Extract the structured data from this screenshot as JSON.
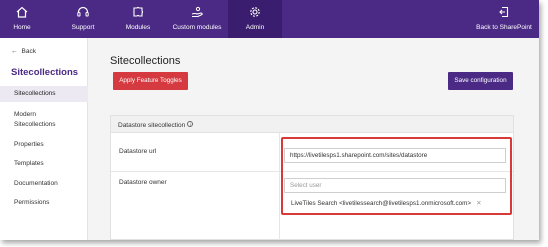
{
  "nav": {
    "items": [
      {
        "label": "Home",
        "icon": "home-icon"
      },
      {
        "label": "Support",
        "icon": "headset-icon"
      },
      {
        "label": "Modules",
        "icon": "puzzle-icon"
      },
      {
        "label": "Custom modules",
        "icon": "hand-icon"
      },
      {
        "label": "Admin",
        "icon": "gear-icon"
      }
    ],
    "back_to_sharepoint": "Back to SharePoint"
  },
  "sidebar": {
    "back_label": "Back",
    "title": "Sitecollections",
    "items": [
      {
        "label": "Sitecollections"
      },
      {
        "label": "Modern"
      },
      {
        "label": "Sitecollections"
      },
      {
        "label": "Properties"
      },
      {
        "label": "Templates"
      },
      {
        "label": "Documentation"
      },
      {
        "label": "Permissions"
      }
    ]
  },
  "main": {
    "title": "Sitecollections",
    "apply_button": "Apply Feature Toggles",
    "save_button": "Save configuration"
  },
  "panel": {
    "heading": "Datastore sitecollection",
    "url_label": "Datastore url",
    "url_value": "https://livetilesps1.sharepoint.com/sites/datastore",
    "owner_label": "Datastore owner",
    "owner_placeholder": "Select user",
    "owner_chip": "LiveTiles Search  <livetilessearch@livetilesps1.onmicrosoft.com>"
  },
  "colors": {
    "nav_bg": "#4b2a86",
    "danger": "#d43a3f",
    "highlight": "#d83a3a"
  }
}
